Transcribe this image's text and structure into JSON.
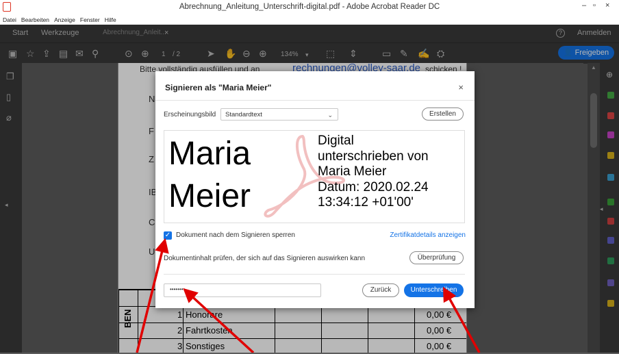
{
  "window": {
    "title": "Abrechnung_Anleitung_Unterschrift-digital.pdf - Adobe Acrobat Reader DC",
    "minimize": "–",
    "restore": "▫",
    "close": "×"
  },
  "menu": [
    "Datei",
    "Bearbeiten",
    "Anzeige",
    "Fenster",
    "Hilfe"
  ],
  "tabs": {
    "start": "Start",
    "tools": "Werkzeuge",
    "document": "Abrechnung_Anleit...",
    "document_close": "×",
    "help": "?",
    "signin": "Anmelden"
  },
  "toolbar": {
    "page_current": "1",
    "page_total": "/ 2",
    "zoom": "134%",
    "share": "Freigeben"
  },
  "page": {
    "header_text": "Bitte vollständig ausfüllen und an",
    "header_email": "rechnungen@volley-saar.de",
    "header_suffix": "schicken !",
    "row_letters": [
      "N",
      "F",
      "Z",
      "IB",
      "C",
      "U"
    ],
    "table_rows": [
      {
        "num": "1",
        "label": "Honorare",
        "amount": "0,00 €"
      },
      {
        "num": "2",
        "label": "Fahrtkosten",
        "amount": "0,00 €"
      },
      {
        "num": "3",
        "label": "Sonstiges",
        "amount": "0,00 €"
      }
    ],
    "vertical_label": "BEN"
  },
  "dialog": {
    "title": "Signieren als \"Maria Meier\"",
    "close": "×",
    "appearance_label": "Erscheinungsbild",
    "appearance_value": "Standardtext",
    "create_button": "Erstellen",
    "preview_name_line1": "Maria",
    "preview_name_line2": "Meier",
    "preview_text": [
      "Digital",
      "unterschrieben von",
      "Maria Meier",
      "Datum: 2020.02.24",
      "13:34:12 +01'00'"
    ],
    "lock_checked": true,
    "lock_label": "Dokument nach dem Signieren sperren",
    "cert_link": "Zertifikatdetails anzeigen",
    "review_text": "Dokumentinhalt prüfen, der sich auf das Signieren auswirken kann",
    "review_button": "Überprüfung",
    "password_value": "••••••••",
    "back_button": "Zurück",
    "sign_button": "Unterschreiben"
  },
  "colors": {
    "accent": "#1473e6",
    "annotation_arrow": "#e00000",
    "chrome_dark": "#3a3a3a"
  }
}
